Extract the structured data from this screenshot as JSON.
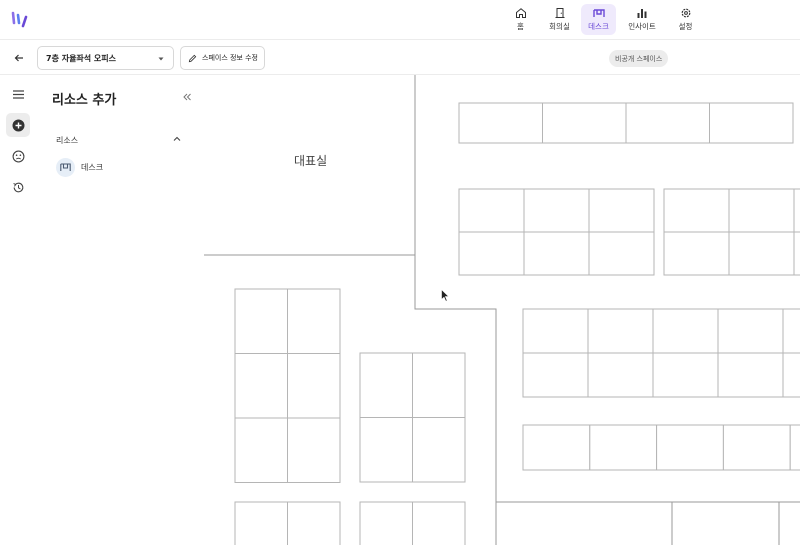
{
  "nav": {
    "items": [
      {
        "label": "홈",
        "icon": "home-icon"
      },
      {
        "label": "회의실",
        "icon": "door-icon"
      },
      {
        "label": "데스크",
        "icon": "desk-icon",
        "active": true
      },
      {
        "label": "인사이트",
        "icon": "bar-chart-icon"
      },
      {
        "label": "설정",
        "icon": "gear-icon"
      }
    ]
  },
  "subbar": {
    "space_name": "7층 자율좌석 오피스",
    "edit_label": "스페이스 정보 수정",
    "visibility_badge": "비공개 스페이스"
  },
  "panel": {
    "title": "리소스 추가",
    "section_label": "리소스",
    "resource_item": "데스크"
  },
  "map": {
    "room_label": "대표실"
  },
  "colors": {
    "accent": "#6a49d6",
    "accent_bg": "#efeafc",
    "line": "#9a9a9a"
  }
}
